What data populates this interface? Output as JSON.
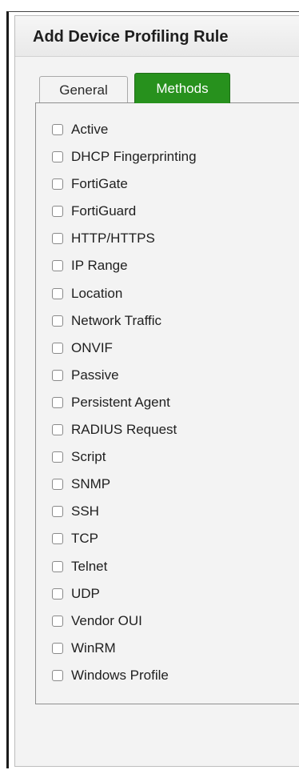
{
  "dialog": {
    "title": "Add Device Profiling Rule"
  },
  "tabs": [
    {
      "label": "General",
      "active": false
    },
    {
      "label": "Methods",
      "active": true
    }
  ],
  "colors": {
    "active_tab": "#27911d",
    "dialog_bg": "#f3f3f3"
  },
  "methods": [
    {
      "label": "Active",
      "checked": false
    },
    {
      "label": "DHCP Fingerprinting",
      "checked": false
    },
    {
      "label": "FortiGate",
      "checked": false
    },
    {
      "label": "FortiGuard",
      "checked": false
    },
    {
      "label": "HTTP/HTTPS",
      "checked": false
    },
    {
      "label": "IP Range",
      "checked": false
    },
    {
      "label": "Location",
      "checked": false
    },
    {
      "label": "Network Traffic",
      "checked": false
    },
    {
      "label": "ONVIF",
      "checked": false
    },
    {
      "label": "Passive",
      "checked": false
    },
    {
      "label": "Persistent Agent",
      "checked": false
    },
    {
      "label": "RADIUS Request",
      "checked": false
    },
    {
      "label": "Script",
      "checked": false
    },
    {
      "label": "SNMP",
      "checked": false
    },
    {
      "label": "SSH",
      "checked": false
    },
    {
      "label": "TCP",
      "checked": false
    },
    {
      "label": "Telnet",
      "checked": false
    },
    {
      "label": "UDP",
      "checked": false
    },
    {
      "label": "Vendor OUI",
      "checked": false
    },
    {
      "label": "WinRM",
      "checked": false
    },
    {
      "label": "Windows Profile",
      "checked": false
    }
  ]
}
